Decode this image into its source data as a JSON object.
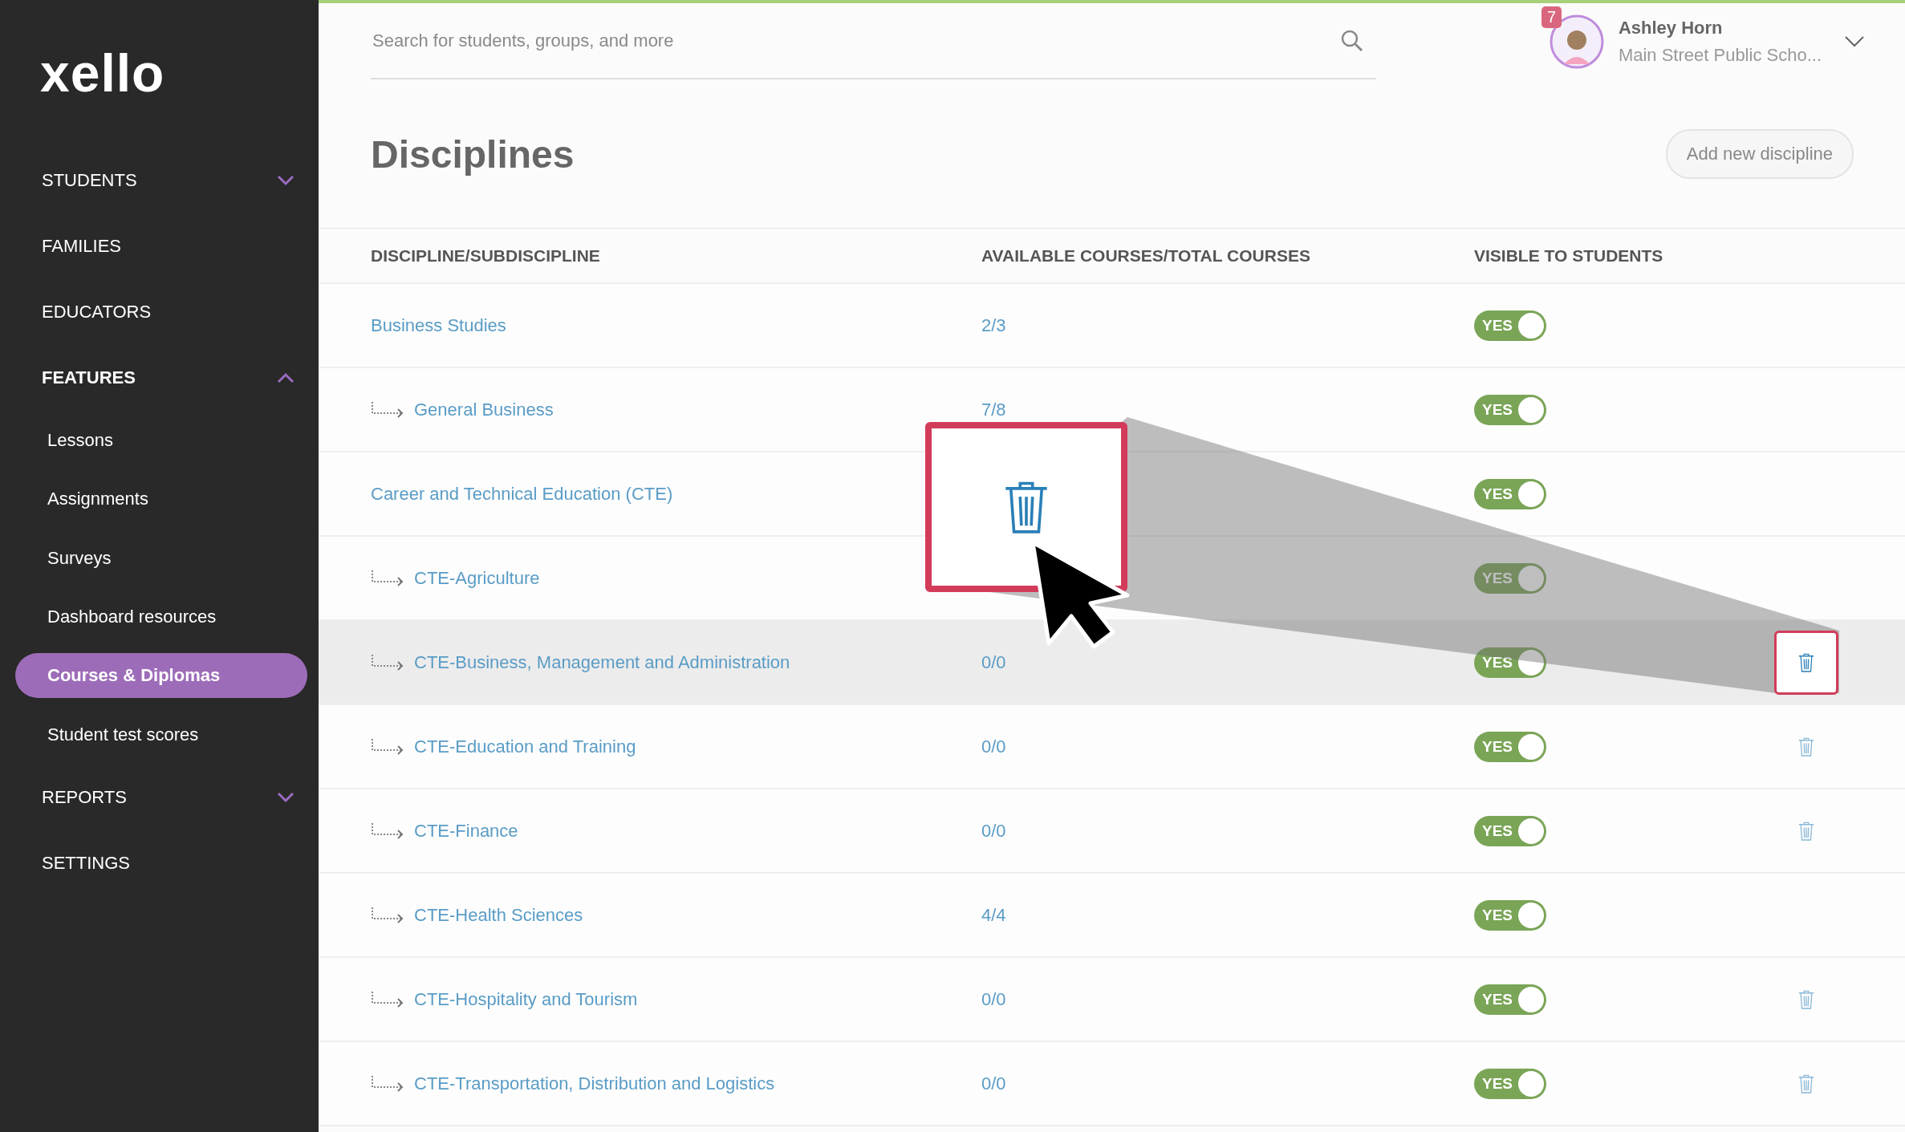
{
  "logo": "xello",
  "sidebar": [
    {
      "label": "STUDENTS",
      "kind": "section",
      "expanded": false,
      "selected": false
    },
    {
      "label": "FAMILIES",
      "kind": "section",
      "selected": false
    },
    {
      "label": "EDUCATORS",
      "kind": "section",
      "selected": false
    },
    {
      "label": "FEATURES",
      "kind": "section",
      "expanded": true,
      "selected": true,
      "children": [
        {
          "label": "Lessons",
          "kind": "sub",
          "selected": false
        },
        {
          "label": "Assignments",
          "kind": "sub",
          "selected": false
        },
        {
          "label": "Surveys",
          "kind": "sub",
          "selected": false
        },
        {
          "label": "Dashboard resources",
          "kind": "sub",
          "selected": false
        },
        {
          "label": "Courses & Diplomas",
          "kind": "sub",
          "selected": true
        },
        {
          "label": "Student test scores",
          "kind": "sub",
          "selected": false
        }
      ]
    },
    {
      "label": "REPORTS",
      "kind": "section",
      "expanded": false,
      "selected": false
    },
    {
      "label": "SETTINGS",
      "kind": "section",
      "selected": false
    }
  ],
  "search": {
    "placeholder": "Search for students, groups, and more"
  },
  "user": {
    "name": "Ashley Horn",
    "school": "Main Street Public Scho...",
    "badge": "7"
  },
  "page_title": "Disciplines",
  "add_button": "Add new discipline",
  "table": {
    "columns": [
      "DISCIPLINE/SUBDISCIPLINE",
      "AVAILABLE COURSES/TOTAL COURSES",
      "VISIBLE TO STUDENTS"
    ],
    "zoom_callout": true,
    "rows": [
      {
        "name": "Business Studies",
        "count": "2/3",
        "visible": true,
        "toggle_label": "YES",
        "deletable": false,
        "hovered": false,
        "children": [
          {
            "name": "General Business",
            "count": "7/8",
            "visible": true,
            "toggle_label": "YES",
            "deletable": false,
            "hovered": false
          }
        ]
      },
      {
        "name": "Career and Technical Education (CTE)",
        "visible": true,
        "toggle_label": "YES",
        "deletable": false,
        "hovered": false,
        "children": [
          {
            "name": "CTE-Agriculture",
            "visible": true,
            "toggle_label": "YES",
            "deletable": false,
            "hovered": false
          },
          {
            "name": "CTE-Business, Management and Administration",
            "count": "0/0",
            "visible": true,
            "toggle_label": "YES",
            "deletable": true,
            "hovered": true
          },
          {
            "name": "CTE-Education and Training",
            "count": "0/0",
            "visible": true,
            "toggle_label": "YES",
            "deletable": true,
            "hovered": false
          },
          {
            "name": "CTE-Finance",
            "count": "0/0",
            "visible": true,
            "toggle_label": "YES",
            "deletable": true,
            "hovered": false
          },
          {
            "name": "CTE-Health Sciences",
            "count": "4/4",
            "visible": true,
            "toggle_label": "YES",
            "deletable": false,
            "hovered": false
          },
          {
            "name": "CTE-Hospitality and Tourism",
            "count": "0/0",
            "visible": true,
            "toggle_label": "YES",
            "deletable": true,
            "hovered": false
          },
          {
            "name": "CTE-Transportation, Distribution and Logistics",
            "count": "0/0",
            "visible": true,
            "toggle_label": "YES",
            "deletable": true,
            "hovered": false
          }
        ]
      }
    ]
  }
}
